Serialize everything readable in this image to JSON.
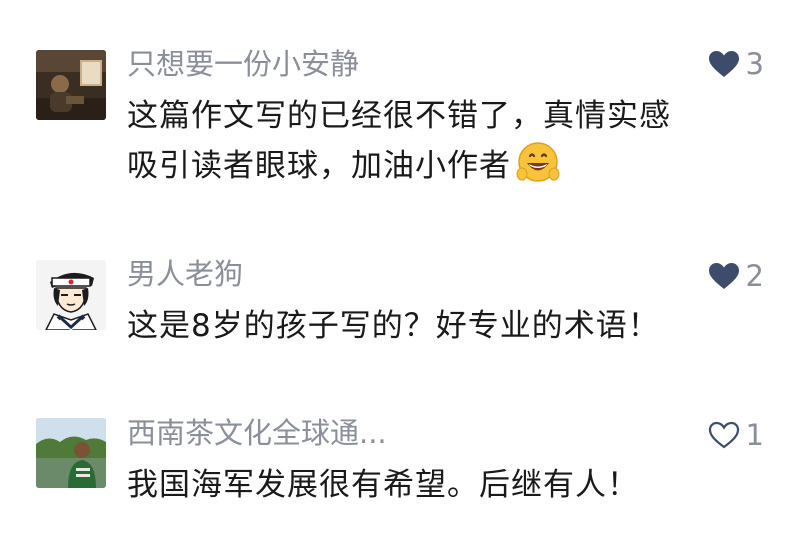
{
  "comments": [
    {
      "username": "只想要一份小安静",
      "likes": "3",
      "liked": true,
      "line1": "这篇作文写的已经很不错了，真情实感",
      "line2": "吸引读者眼球，加油小作者",
      "emoji": "grinning-face-emoji"
    },
    {
      "username": "男人老狗",
      "likes": "2",
      "liked": true,
      "line1": "这是8岁的孩子写的？好专业的术语！"
    },
    {
      "username": "西南茶文化全球通...",
      "likes": "1",
      "liked": false,
      "line1": "我国海军发展很有希望。后继有人！"
    }
  ],
  "colors": {
    "liked_heart": "#3d4c6b",
    "username": "#8a8f99",
    "text": "#1a1a1a"
  }
}
